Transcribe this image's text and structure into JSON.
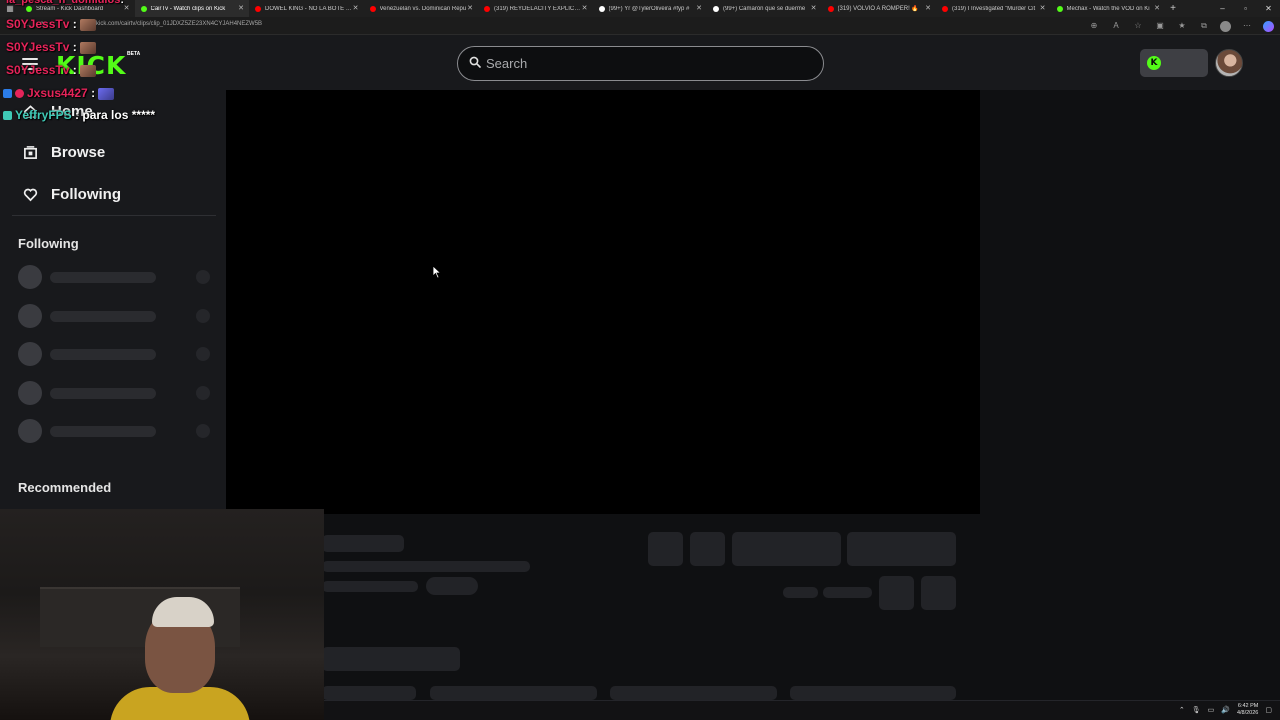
{
  "browser": {
    "tabs": [
      {
        "title": "Stream - Kick Dashboard",
        "favicon": "#53fc18",
        "active": false
      },
      {
        "title": "CairTv - Watch clips on Kick",
        "favicon": "#53fc18",
        "active": true
      },
      {
        "title": "DOWEL KING - NO LA BOTE | Vi",
        "favicon": "#ff0000",
        "active": false
      },
      {
        "title": "Venezuelan vs. Dominican Repu",
        "favicon": "#ff0000",
        "active": false
      },
      {
        "title": "(319) REYDELACITY EXPLICA PO",
        "favicon": "#ff0000",
        "active": false
      },
      {
        "title": "(99+) Yr @TylerOliveira #fyp #",
        "favicon": "#ffffff",
        "active": false
      },
      {
        "title": "(99+) Camarón que se duerme",
        "favicon": "#ffffff",
        "active": false
      },
      {
        "title": "(319) VOLVIO A ROMPER! 🔥",
        "favicon": "#ff0000",
        "active": false
      },
      {
        "title": "(319) I Investigated \"Murder Cit",
        "favicon": "#ff0000",
        "active": false
      },
      {
        "title": "Mechax - Watch the VOD on Ki",
        "favicon": "#53fc18",
        "active": false
      }
    ],
    "new_tab": "+",
    "url": "kick.com/cairtv/clips/clip_01JDXZ5ZE23XN4CYJAH4NEZW5B",
    "window_controls": [
      "–",
      "▫",
      "✕"
    ]
  },
  "header": {
    "logo_text": "KICK",
    "beta_label": "BETA",
    "search_placeholder": "Search",
    "search_value": ""
  },
  "sidebar": {
    "nav": [
      {
        "label": "Home",
        "icon": "home-icon"
      },
      {
        "label": "Browse",
        "icon": "browse-icon"
      },
      {
        "label": "Following",
        "icon": "heart-icon"
      }
    ],
    "following_title": "Following",
    "recommended_title": "Recommended"
  },
  "chat_overlay": {
    "lines": [
      {
        "user": "la_pesca_n_domidios",
        "message": ""
      },
      {
        "user": "S0YJessTv",
        "message": ""
      },
      {
        "user": "S0YJessTv",
        "message": ""
      },
      {
        "user": "Jxsus4427",
        "message": ""
      },
      {
        "user": "YeffryFPS",
        "message": "para los *****"
      }
    ]
  },
  "taskbar": {
    "time": "6:42 PM",
    "date": "4/8/2026"
  },
  "colors": {
    "brand": "#53fc18",
    "chat_user": "#e6245a",
    "chat_user_alt": "#3fc9b6"
  }
}
